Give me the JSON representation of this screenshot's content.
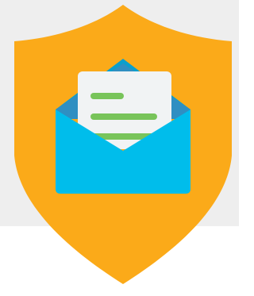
{
  "illustration": {
    "subject": "shield-with-open-envelope-icon",
    "colors": {
      "shield": "#FBAA19",
      "envelope_front": "#00BDEB",
      "envelope_back": "#0B9FCC",
      "envelope_flap": "#2F8FC2",
      "letter_paper": "#F1F3F4",
      "letter_lines": "#78C45A",
      "background_panel": "#EEEEEE",
      "background_bottom": "#FFFFFF"
    }
  }
}
